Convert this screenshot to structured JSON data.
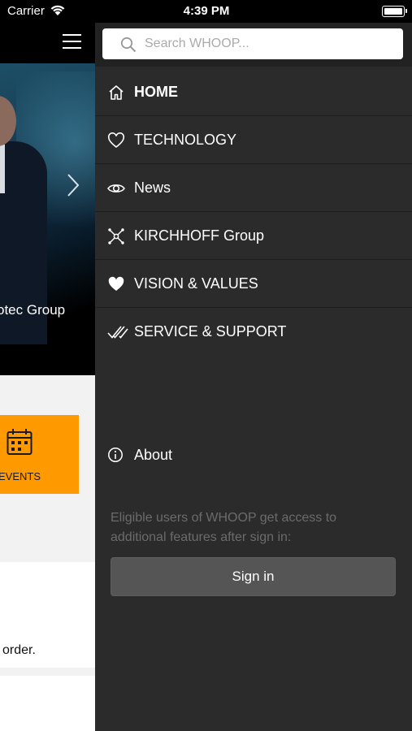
{
  "status_bar": {
    "carrier": "Carrier",
    "time": "4:39 PM"
  },
  "background_screen": {
    "hero_text": "otec Group",
    "events_label": "EVENTS",
    "card_text": "order."
  },
  "drawer": {
    "search": {
      "placeholder": "Search WHOOP..."
    },
    "menu": [
      {
        "label": "HOME",
        "icon": "home-icon",
        "active": true
      },
      {
        "label": "TECHNOLOGY",
        "icon": "heart-outline-icon"
      },
      {
        "label": "News",
        "icon": "eye-icon"
      },
      {
        "label": "KIRCHHOFF Group",
        "icon": "network-icon"
      },
      {
        "label": "VISION & VALUES",
        "icon": "heart-filled-icon"
      },
      {
        "label": "SERVICE & SUPPORT",
        "icon": "double-check-icon"
      }
    ],
    "about_label": "About",
    "signin_note": "Eligible users of WHOOP get access to additional features after sign in:",
    "signin_button": "Sign in"
  },
  "colors": {
    "drawer_bg": "#2b2b2b",
    "accent_orange": "#ff9900",
    "button_bg": "#555555"
  }
}
